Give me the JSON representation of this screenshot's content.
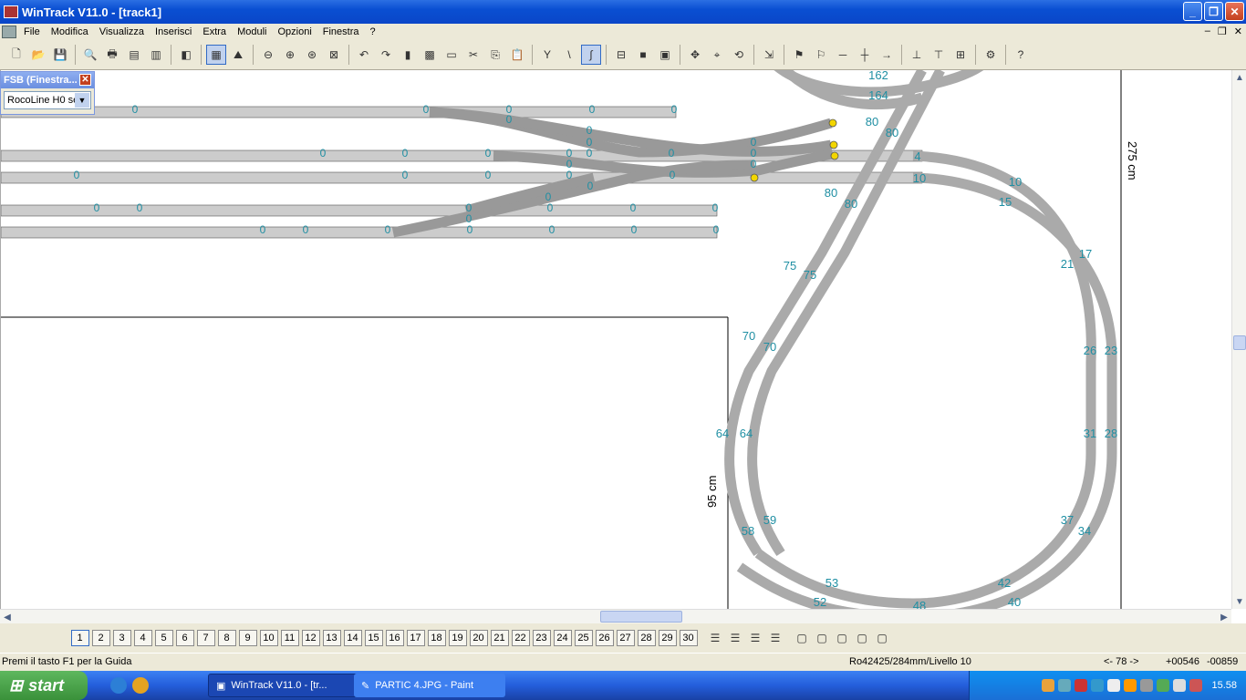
{
  "window": {
    "title": "WinTrack  V11.0 - [track1]"
  },
  "menu": [
    "File",
    "Modifica",
    "Visualizza",
    "Inserisci",
    "Extra",
    "Moduli",
    "Opzioni",
    "Finestra",
    "?"
  ],
  "fsb": {
    "title": "FSB (Finestra...",
    "selected": "RocoLine H0 se"
  },
  "canvas": {
    "dimension_labels": {
      "width": "275 cm",
      "height": "95 cm"
    },
    "track_labels_left": [
      "0",
      "0",
      "0",
      "0",
      "0",
      "0",
      "0",
      "0",
      "0",
      "0",
      "0",
      "0",
      "0",
      "0",
      "0",
      "0",
      "0",
      "0",
      "0",
      "0",
      "0",
      "0",
      "0",
      "0",
      "0",
      "0",
      "0",
      "0",
      "0",
      "0",
      "0",
      "0",
      "0",
      "0",
      "0",
      "0",
      "0",
      "0",
      "0"
    ],
    "loop_labels": [
      "162",
      "164",
      "80",
      "80",
      "80",
      "80",
      "4",
      "10",
      "10",
      "15",
      "17",
      "21",
      "26",
      "23",
      "31",
      "28",
      "37",
      "34",
      "42",
      "40",
      "48",
      "53",
      "52",
      "58",
      "59",
      "64",
      "64",
      "70",
      "70",
      "75",
      "75"
    ]
  },
  "pages": [
    "1",
    "2",
    "3",
    "4",
    "5",
    "6",
    "7",
    "8",
    "9",
    "10",
    "11",
    "12",
    "13",
    "14",
    "15",
    "16",
    "17",
    "18",
    "19",
    "20",
    "21",
    "22",
    "23",
    "24",
    "25",
    "26",
    "27",
    "28",
    "29",
    "30"
  ],
  "status": {
    "help": "Premi il tasto F1 per la Guida",
    "info": "Ro42425/284mm/Livello 10",
    "nav": "<- 78 ->",
    "coord_x": "+00546",
    "coord_y": "-00859"
  },
  "taskbar": {
    "start": "start",
    "tasks": [
      "WinTrack  V11.0 - [tr...",
      "PARTIC 4.JPG - Paint"
    ],
    "clock": "15.58"
  },
  "colors": {
    "accent": "#0a4fd2",
    "track_fill": "#cccccc",
    "label": "#1f8fa3"
  }
}
